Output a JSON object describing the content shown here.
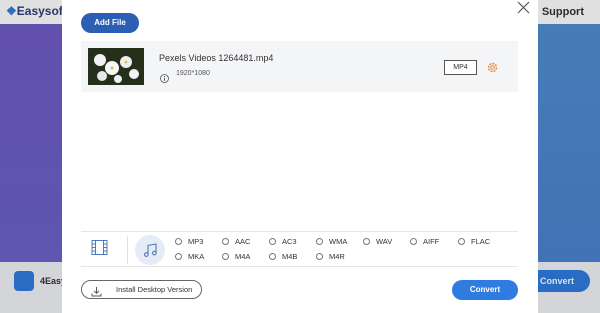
{
  "background": {
    "logo_text": "Easysof",
    "support_label": "Support",
    "app_name": "4Easy",
    "convert_label": "o Convert"
  },
  "dialog": {
    "add_file_label": "Add File",
    "file": {
      "name": "Pexels Videos 1264481.mp4",
      "resolution": "1920*1080",
      "format": "MP4"
    },
    "audio_formats": [
      [
        "MP3",
        "AAC",
        "AC3",
        "WMA",
        "WAV",
        "AIFF",
        "FLAC"
      ],
      [
        "MKA",
        "M4A",
        "M4B",
        "M4R"
      ]
    ],
    "install_label": "Install Desktop Version",
    "convert_label": "Convert"
  },
  "colors": {
    "primary": "#2f7be0",
    "add_file": "#2a5fb4",
    "gear": "#e8833a"
  },
  "icons": [
    "close-icon",
    "info-icon",
    "gear-icon",
    "film-icon",
    "music-note-icon",
    "download-icon"
  ]
}
